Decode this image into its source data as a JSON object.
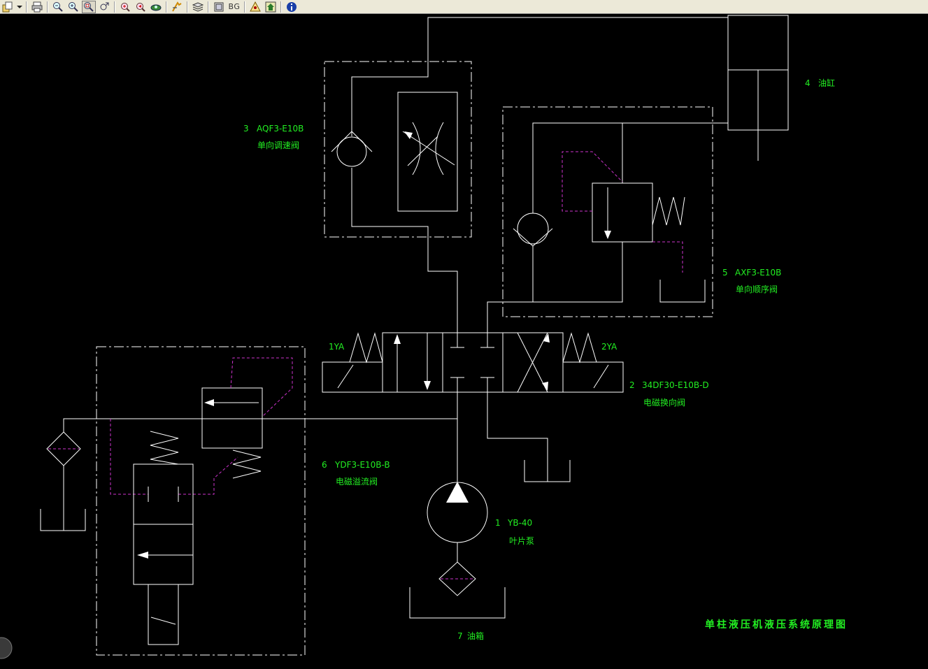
{
  "toolbar": {
    "bg_label": "BG",
    "buttons": [
      "open-icon",
      "print-icon",
      "zoom-out-icon",
      "zoom-in-icon",
      "zoom-window-icon",
      "zoom-pan-icon",
      "zoom-extents-icon",
      "zoom-previous-icon",
      "view-3d-icon",
      "measure-icon",
      "layers-icon",
      "frame-icon",
      "background-toggle",
      "lock-icon",
      "home-icon",
      "info-icon"
    ]
  },
  "labels": {
    "pump_num": "1",
    "pump_model": "YB-40",
    "pump_name": "叶片泵",
    "dirvalve_num": "2",
    "dirvalve_model": "34DF30-E10B-D",
    "dirvalve_name": "电磁换向阀",
    "throttle_num": "3",
    "throttle_model": "AQF3-E10B",
    "throttle_name": "单向调速阀",
    "cylinder_num": "4",
    "cylinder_name": "油缸",
    "seqvalve_num": "5",
    "seqvalve_model": "AXF3-E10B",
    "seqvalve_name": "单向顺序阀",
    "relief_num": "6",
    "relief_model": "YDF3-E10B-B",
    "relief_name": "电磁溢流阀",
    "tank_num": "7",
    "tank_name": "油箱",
    "solenoid_1": "1YA",
    "solenoid_2": "2YA",
    "diagram_title": "单柱液压机液压系统原理图"
  },
  "colors": {
    "background": "#000000",
    "line": "#ffffff",
    "label": "#22ee22",
    "pilot_line": "#cc33cc",
    "toolbar": "#ece9d8"
  }
}
